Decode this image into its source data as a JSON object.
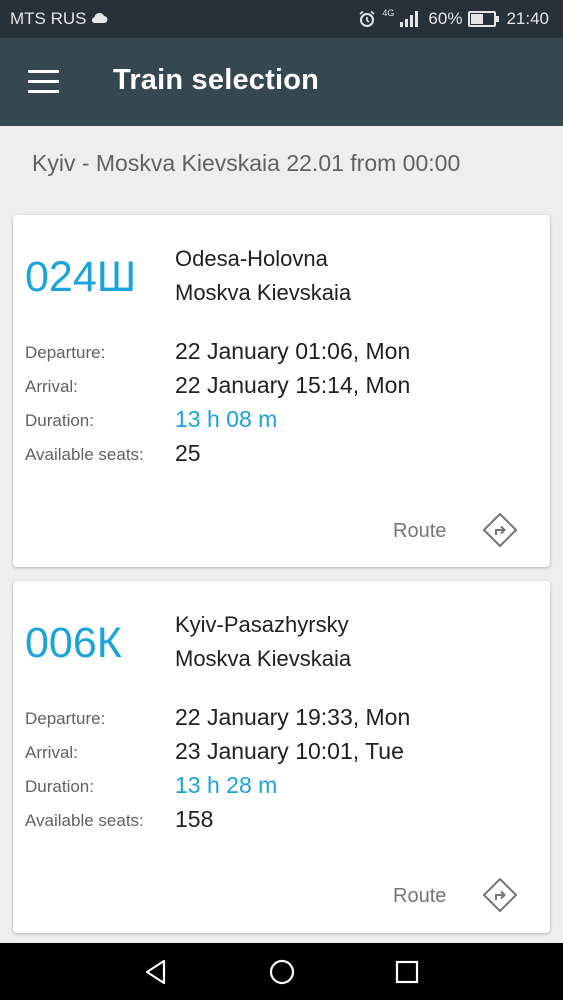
{
  "status_bar": {
    "carrier": "MTS RUS",
    "network": "4G",
    "battery_percent": "60%",
    "battery_level": 0.6,
    "time": "21:40"
  },
  "app_bar": {
    "title": "Train selection",
    "menu_icon": "hamburger-menu-icon"
  },
  "search_summary": "Kyiv - Moskva Kievskaia 22.01 from 00:00",
  "labels": {
    "departure": "Departure:",
    "arrival": "Arrival:",
    "duration": "Duration:",
    "seats": "Available seats:",
    "route": "Route"
  },
  "trains": [
    {
      "number": "024Ш",
      "from": "Odesa-Holovna",
      "to": "Moskva Kievskaia",
      "departure": "22 January 01:06, Mon",
      "arrival": "22 January 15:14, Mon",
      "duration": "13 h 08 m",
      "seats": "25"
    },
    {
      "number": "006К",
      "from": "Kyiv-Pasazhyrsky",
      "to": "Moskva Kievskaia",
      "departure": "22 January 19:33, Mon",
      "arrival": "23 January 10:01, Tue",
      "duration": "13 h 28 m",
      "seats": "158"
    }
  ],
  "colors": {
    "accent": "#1ba3dc",
    "app_bar": "#37474f",
    "status_bar": "#263238",
    "background": "#eeeeee"
  }
}
